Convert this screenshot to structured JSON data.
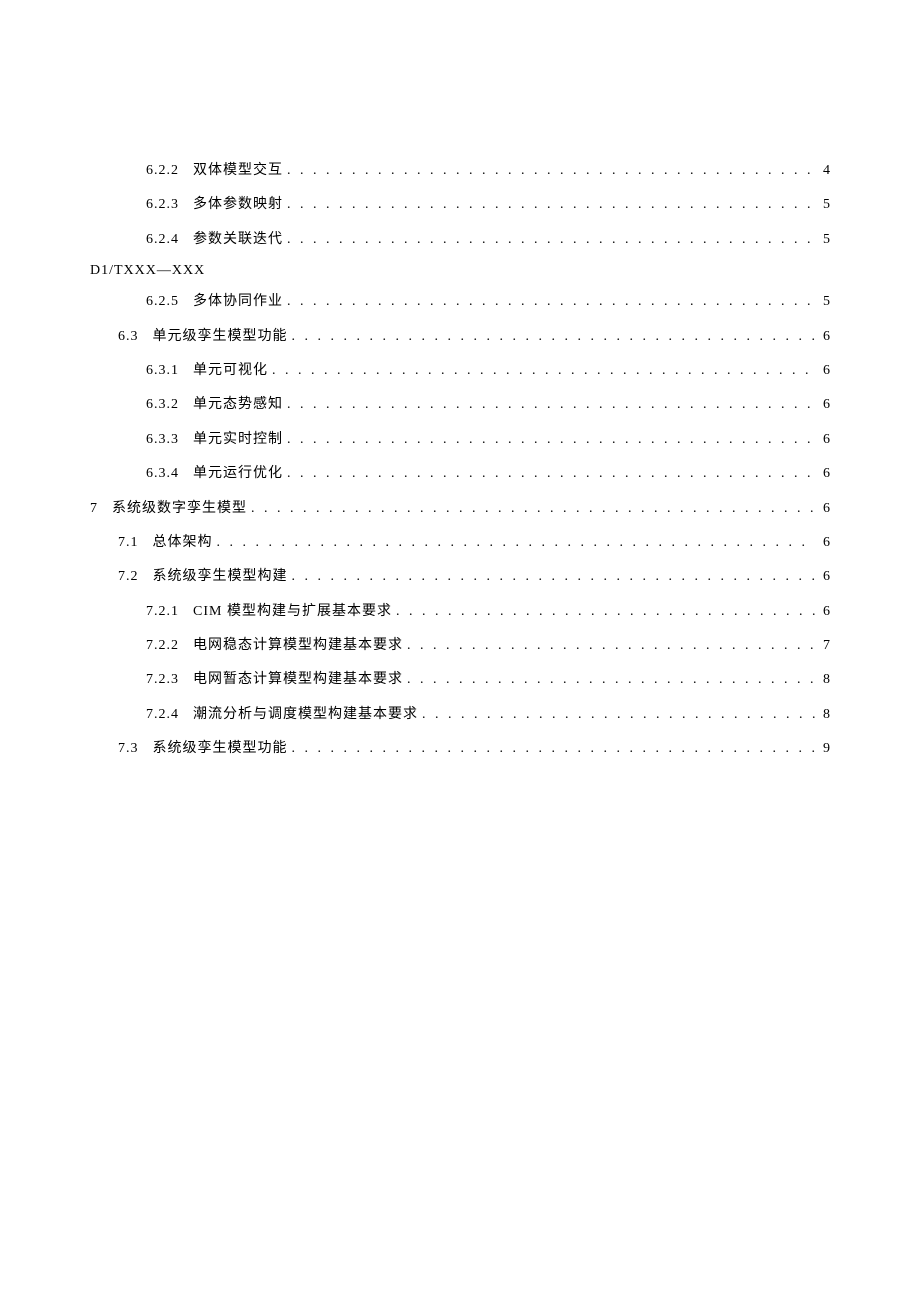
{
  "doc_code": "D1/TXXX—XXX",
  "toc": [
    {
      "indent": 2,
      "num": "6.2.2",
      "title": "双体模型交互",
      "page": "4",
      "break_after": false
    },
    {
      "indent": 2,
      "num": "6.2.3",
      "title": "多体参数映射",
      "page": "5",
      "break_after": false
    },
    {
      "indent": 2,
      "num": "6.2.4",
      "title": "参数关联迭代",
      "page": "5",
      "break_after": true
    },
    {
      "indent": 2,
      "num": "6.2.5",
      "title": "多体协同作业",
      "page": "5",
      "break_after": false
    },
    {
      "indent": 1,
      "num": "6.3",
      "title": "单元级孪生模型功能",
      "page": "6",
      "break_after": false
    },
    {
      "indent": 2,
      "num": "6.3.1",
      "title": "单元可视化",
      "page": "6",
      "break_after": false
    },
    {
      "indent": 2,
      "num": "6.3.2",
      "title": "单元态势感知",
      "page": "6",
      "break_after": false
    },
    {
      "indent": 2,
      "num": "6.3.3",
      "title": "单元实时控制",
      "page": "6",
      "break_after": false
    },
    {
      "indent": 2,
      "num": "6.3.4",
      "title": "单元运行优化",
      "page": "6",
      "break_after": false
    },
    {
      "indent": 0,
      "num": "7",
      "title": "系统级数字孪生模型",
      "page": "6",
      "break_after": false
    },
    {
      "indent": 1,
      "num": "7.1",
      "title": "总体架构",
      "page": "6",
      "break_after": false
    },
    {
      "indent": 1,
      "num": "7.2",
      "title": "系统级孪生模型构建",
      "page": "6",
      "break_after": false
    },
    {
      "indent": 2,
      "num": "7.2.1",
      "title": "CIM 模型构建与扩展基本要求",
      "page": "6",
      "break_after": false
    },
    {
      "indent": 2,
      "num": "7.2.2",
      "title": "电网稳态计算模型构建基本要求",
      "page": "7",
      "break_after": false
    },
    {
      "indent": 2,
      "num": "7.2.3",
      "title": "电网暂态计算模型构建基本要求",
      "page": "8",
      "break_after": false
    },
    {
      "indent": 2,
      "num": "7.2.4",
      "title": "潮流分析与调度模型构建基本要求",
      "page": "8",
      "break_after": false
    },
    {
      "indent": 1,
      "num": "7.3",
      "title": "系统级孪生模型功能",
      "page": "9",
      "break_after": false
    }
  ]
}
